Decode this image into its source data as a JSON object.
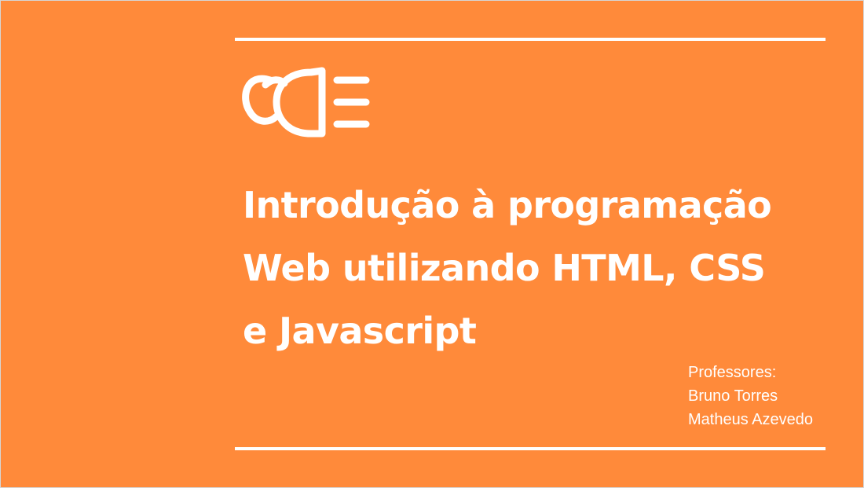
{
  "slide": {
    "background_color": "#FF8A3A",
    "accent_color": "#FFFFFF",
    "logo_icon": "code-editor-logo-icon",
    "title_lines": [
      "Introdução à programação",
      "Web utilizando HTML, CSS",
      "e Javascript"
    ],
    "credits": {
      "heading": "Professores:",
      "names": [
        "Bruno Torres",
        "Matheus Azevedo"
      ]
    }
  }
}
